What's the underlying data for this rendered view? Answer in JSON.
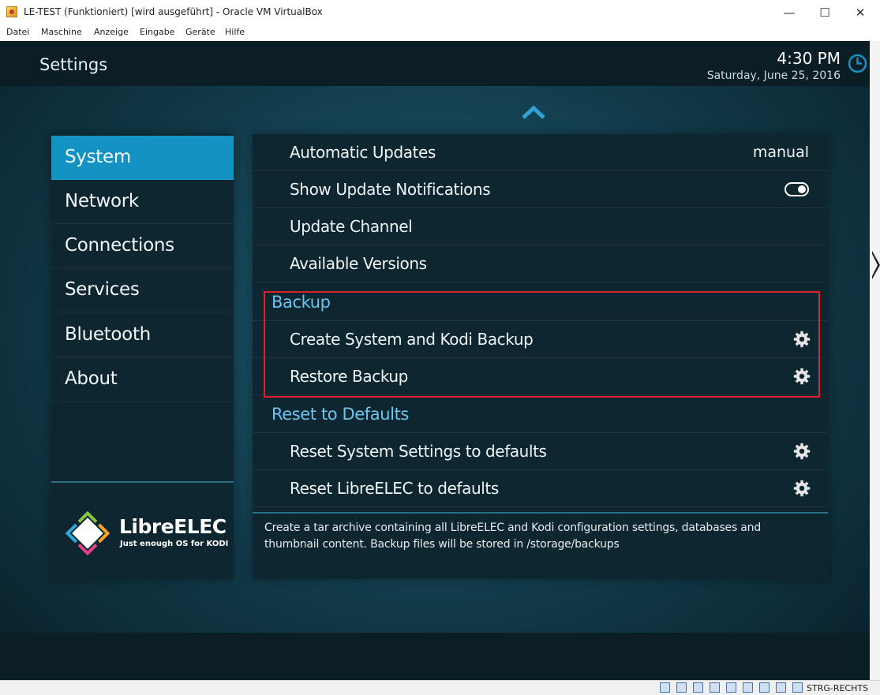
{
  "window": {
    "title": "LE-TEST (Funktioniert) [wird ausgeführt] - Oracle VM VirtualBox",
    "minimize_glyph": "—",
    "maximize_glyph": "☐",
    "close_glyph": "✕",
    "menu": [
      "Datei",
      "Maschine",
      "Anzeige",
      "Eingabe",
      "Geräte",
      "Hilfe"
    ],
    "status_text": "STRG-RECHTS"
  },
  "header": {
    "title": "Settings",
    "time": "4:30 PM",
    "date": "Saturday, June 25, 2016"
  },
  "sidebar": {
    "items": [
      {
        "label": "System",
        "active": true
      },
      {
        "label": "Network"
      },
      {
        "label": "Connections"
      },
      {
        "label": "Services"
      },
      {
        "label": "Bluetooth"
      },
      {
        "label": "About"
      }
    ],
    "logo_name": "LibreELEC",
    "logo_tagline": "Just enough OS for KODI"
  },
  "settings": {
    "automatic_updates": {
      "label": "Automatic Updates",
      "value": "manual"
    },
    "show_update_notifications": {
      "label": "Show Update Notifications",
      "enabled": true
    },
    "update_channel": {
      "label": "Update Channel"
    },
    "available_versions": {
      "label": "Available Versions"
    },
    "backup_header": "Backup",
    "create_backup": {
      "label": "Create System and Kodi Backup"
    },
    "restore_backup": {
      "label": "Restore Backup"
    },
    "reset_header": "Reset to Defaults",
    "reset_system": {
      "label": "Reset System Settings to defaults"
    },
    "reset_libreelec": {
      "label": "Reset LibreELEC to defaults"
    }
  },
  "description": "Create a tar archive containing all LibreELEC and Kodi configuration settings, databases and thumbnail content. Backup files will be stored in /storage/backups",
  "colors": {
    "accent": "#1293c4",
    "section_header": "#6cc3ee",
    "highlight_box": "#e0212b",
    "panel_bg": "#0e2630"
  }
}
